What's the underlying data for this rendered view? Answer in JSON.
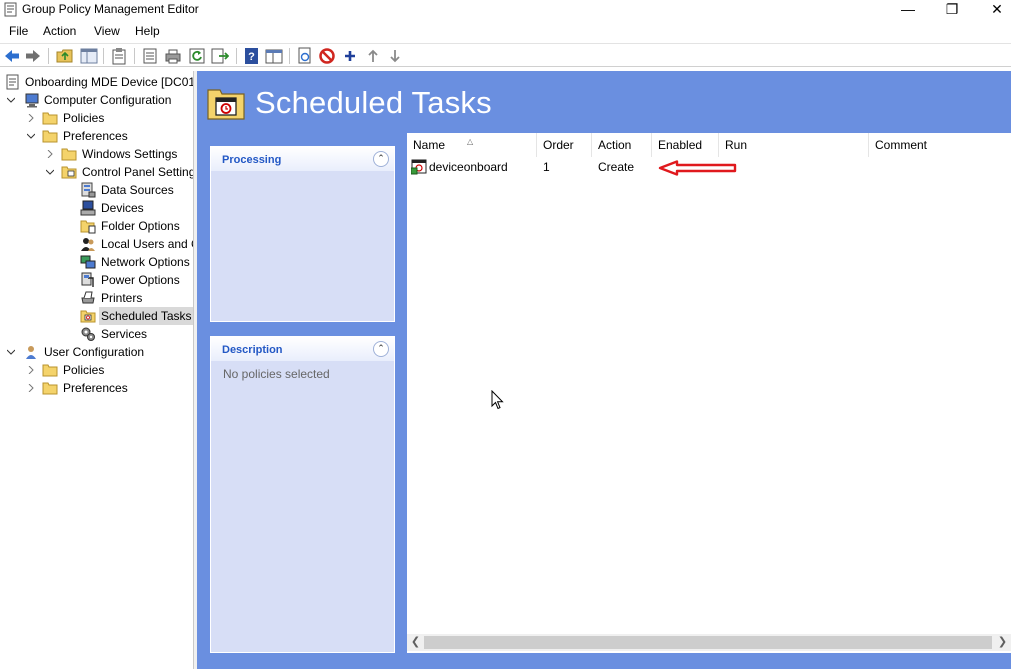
{
  "window": {
    "title": "Group Policy Management Editor"
  },
  "menu": [
    "File",
    "Action",
    "View",
    "Help"
  ],
  "tree": {
    "root": "Onboarding MDE Device [DC01",
    "computer_config": "Computer Configuration",
    "policies": "Policies",
    "preferences": "Preferences",
    "windows_settings": "Windows Settings",
    "control_panel": "Control Panel Setting",
    "items": [
      "Data Sources",
      "Devices",
      "Folder Options",
      "Local Users and G",
      "Network Options",
      "Power Options",
      "Printers",
      "Scheduled Tasks",
      "Services"
    ],
    "user_config": "User Configuration",
    "user_policies": "Policies",
    "user_preferences": "Preferences"
  },
  "header": {
    "title": "Scheduled Tasks"
  },
  "panels": {
    "processing": {
      "title": "Processing"
    },
    "description": {
      "title": "Description",
      "text": "No policies selected"
    }
  },
  "list": {
    "columns": [
      "Name",
      "Order",
      "Action",
      "Enabled",
      "Run",
      "Comment"
    ],
    "rows": [
      {
        "name": "deviceonboard",
        "order": "1",
        "action": "Create",
        "enabled": "",
        "run": "",
        "comment": ""
      }
    ]
  },
  "colors": {
    "content_bg": "#6a8fe0",
    "panel_bg": "#d7def6",
    "panel_title": "#2358c5",
    "arrow": "#e0191d"
  },
  "icons": [
    "back-icon",
    "forward-icon",
    "folder-up-icon",
    "show-hide-tree-icon",
    "clipboard-icon",
    "properties-icon",
    "print-icon",
    "refresh-icon",
    "export-icon",
    "help-icon",
    "console-icon",
    "new-item-icon",
    "delete-icon",
    "add-icon",
    "move-up-icon",
    "move-down-icon"
  ]
}
